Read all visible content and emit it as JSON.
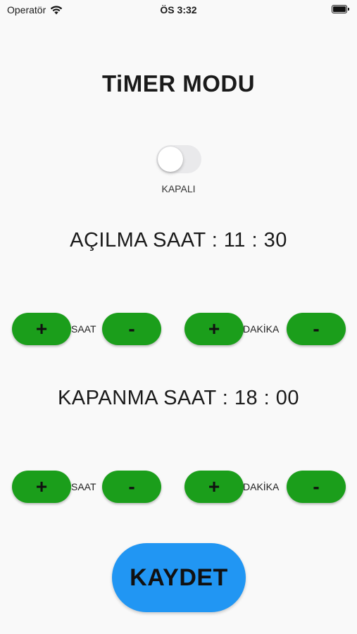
{
  "status_bar": {
    "carrier": "Operatör",
    "time": "ÖS 3:32"
  },
  "title": "TiMER MODU",
  "toggle": {
    "state": "off",
    "label": "KAPALI"
  },
  "opening": {
    "heading": "AÇILMA SAAT : 11 : 30",
    "hour_plus": "+",
    "hour_label": "SAAT",
    "hour_minus": "-",
    "minute_plus": "+",
    "minute_label": "DAKİKA",
    "minute_minus": "-"
  },
  "closing": {
    "heading": "KAPANMA SAAT : 18 : 00",
    "hour_plus": "+",
    "hour_label": "SAAT",
    "hour_minus": "-",
    "minute_plus": "+",
    "minute_label": "DAKİKA",
    "minute_minus": "-"
  },
  "save_label": "KAYDET",
  "colors": {
    "button_green": "#1b9e1b",
    "save_blue": "#2196f3",
    "toggle_off": "#e9e9eb",
    "background": "#f9f9f9"
  },
  "icons": {
    "wifi": "wifi-icon",
    "battery": "battery-icon"
  }
}
